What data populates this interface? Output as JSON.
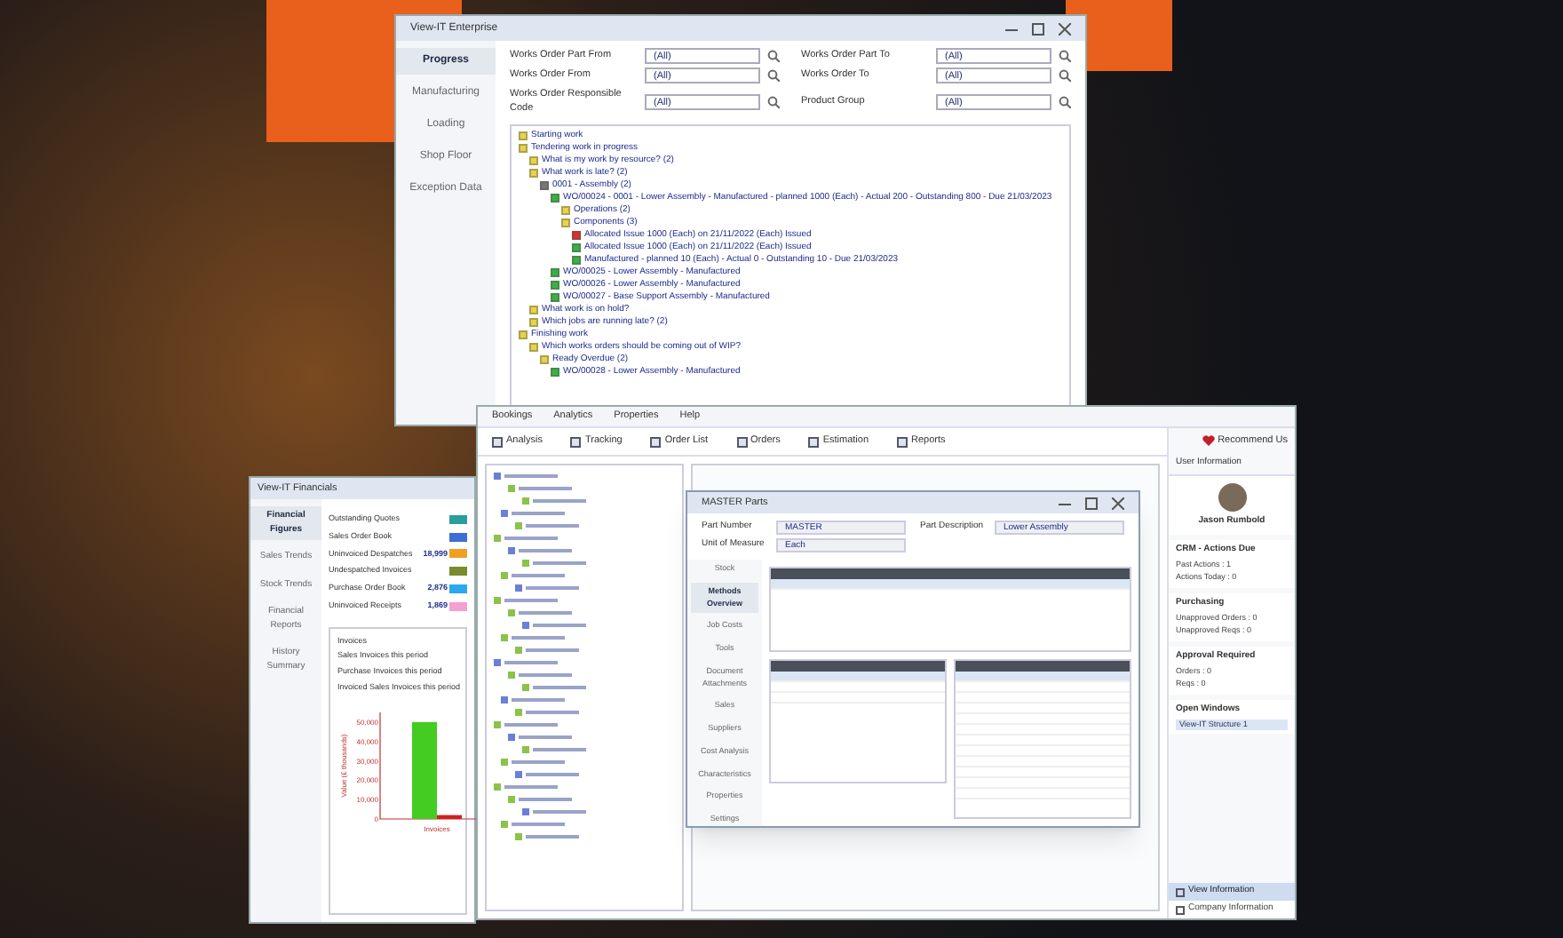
{
  "enterprise_window": {
    "title": "View-IT Enterprise",
    "nav": [
      {
        "label": "Progress",
        "selected": true
      },
      {
        "label": "Manufacturing",
        "selected": false
      },
      {
        "label": "Loading",
        "selected": false
      },
      {
        "label": "Shop Floor",
        "selected": false
      },
      {
        "label": "Exception Data",
        "selected": false
      }
    ],
    "filters": [
      {
        "label": "Works Order Part From",
        "value": "(All)"
      },
      {
        "label": "Works Order From",
        "value": "(All)"
      },
      {
        "label": "Works Order Responsible Code",
        "value": "(All)"
      },
      {
        "label": "Works Order Part To",
        "value": "(All)"
      },
      {
        "label": "Works Order To",
        "value": "(All)"
      },
      {
        "label": "Product Group",
        "value": "(All)"
      }
    ],
    "tree": [
      {
        "label": "Starting work",
        "color": "#e6d44a"
      },
      {
        "label": "Tendering work in progress",
        "color": "#e6d44a",
        "children": [
          {
            "label": "What is my work by resource? (2)",
            "color": "#e6d44a"
          },
          {
            "label": "What work is late? (2)",
            "color": "#e6d44a",
            "children": [
              {
                "label": "0001 - Assembly (2)",
                "color": "#777777",
                "children": [
                  {
                    "label": "WO/00024 - 0001 - Lower Assembly - Manufactured - planned 1000 (Each) - Actual 200 - Outstanding 800 - Due 21/03/2023",
                    "color": "#3cb043",
                    "children": [
                      {
                        "label": "Operations (2)",
                        "color": "#e6d44a"
                      },
                      {
                        "label": "Components (3)",
                        "color": "#e6d44a",
                        "children": [
                          {
                            "label": "Allocated Issue 1000 (Each) on 21/11/2022 (Each) Issued",
                            "color": "#d83030"
                          },
                          {
                            "label": "Allocated Issue 1000 (Each) on 21/11/2022 (Each) Issued",
                            "color": "#3cb043"
                          },
                          {
                            "label": "Manufactured - planned 10 (Each) - Actual 0 - Outstanding 10 - Due 21/03/2023",
                            "color": "#3cb043"
                          }
                        ]
                      }
                    ]
                  },
                  {
                    "label": "WO/00025 - Lower Assembly - Manufactured",
                    "color": "#3cb043"
                  },
                  {
                    "label": "WO/00026 - Lower Assembly - Manufactured",
                    "color": "#3cb043"
                  },
                  {
                    "label": "WO/00027 - Base Support Assembly - Manufactured",
                    "color": "#3cb043"
                  }
                ]
              }
            ]
          },
          {
            "label": "What work is on hold?",
            "color": "#e6d44a"
          },
          {
            "label": "Which jobs are running late? (2)",
            "color": "#e6d44a"
          }
        ]
      },
      {
        "label": "Finishing work",
        "color": "#e6d44a",
        "children": [
          {
            "label": "Which works orders should be coming out of WIP?",
            "color": "#e6d44a",
            "children": [
              {
                "label": "Ready Overdue (2)",
                "color": "#e6d44a",
                "children": [
                  {
                    "label": "WO/00028 - Lower Assembly - Manufactured",
                    "color": "#3cb043"
                  }
                ]
              }
            ]
          }
        ]
      }
    ]
  },
  "erp_window": {
    "menu": [
      {
        "label": "Bookings"
      },
      {
        "label": "Analytics"
      },
      {
        "label": "Properties"
      },
      {
        "label": "Help"
      }
    ],
    "toolbar": [
      {
        "label": "Analysis"
      },
      {
        "label": "Tracking"
      },
      {
        "label": "Order List"
      },
      {
        "label": "Orders"
      },
      {
        "label": "Estimation"
      },
      {
        "label": "Reports"
      }
    ],
    "recommend": "Recommend Us",
    "side_panel": {
      "header": "User Information",
      "user": "Jason Rumbold",
      "sections": [
        {
          "title": "CRM - Actions Due",
          "lines": [
            "Past Actions : 1",
            "Actions Today : 0"
          ]
        },
        {
          "title": "Purchasing",
          "lines": [
            "Unapproved Orders : 0",
            "Unapproved Reqs : 0"
          ]
        },
        {
          "title": "Approval Required",
          "lines": [
            "Orders : 0",
            "Reqs : 0"
          ]
        },
        {
          "title": "Open Windows",
          "lines": [
            "View-IT Structure 1"
          ]
        }
      ],
      "footer": [
        {
          "label": "View Information",
          "selected": true
        },
        {
          "label": "Company Information",
          "selected": false
        }
      ]
    }
  },
  "parts_dialog": {
    "title": "MASTER Parts",
    "fields": [
      {
        "label": "Part Number",
        "value": "MASTER"
      },
      {
        "label": "Part Description",
        "value": "Lower Assembly"
      },
      {
        "label": "Unit of Measure",
        "value": "Each"
      }
    ],
    "nav": [
      {
        "label": "Stock",
        "selected": false
      },
      {
        "label": "Methods Overview",
        "selected": true
      },
      {
        "label": "Job Costs",
        "selected": false
      },
      {
        "label": "Tools",
        "selected": false
      },
      {
        "label": "Document Attachments",
        "selected": false
      },
      {
        "label": "Sales",
        "selected": false
      },
      {
        "label": "Suppliers",
        "selected": false
      },
      {
        "label": "Cost Analysis",
        "selected": false
      },
      {
        "label": "Characteristics",
        "selected": false
      },
      {
        "label": "Properties",
        "selected": false
      },
      {
        "label": "Settings",
        "selected": false
      }
    ]
  },
  "financials_window": {
    "title": "View-IT Financials",
    "nav": [
      {
        "label": "Financial Figures",
        "selected": true
      },
      {
        "label": "Sales Trends",
        "selected": false
      },
      {
        "label": "Stock Trends",
        "selected": false
      },
      {
        "label": "Financial Reports",
        "selected": false
      },
      {
        "label": "History Summary",
        "selected": false
      }
    ],
    "figures": [
      {
        "label": "Outstanding Quotes",
        "color": "#2a9d9d"
      },
      {
        "label": "Sales Order Book",
        "color": "#3b6fd6"
      },
      {
        "label": "Uninvoiced Despatches",
        "value": "18,999",
        "color": "#f0a020"
      },
      {
        "label": "Undespatched Invoices",
        "color": "#7a8a30"
      },
      {
        "label": "Purchase Order Book",
        "value": "2,876",
        "color": "#2aa8f0"
      },
      {
        "label": "Uninvoiced Receipts",
        "value": "1,869",
        "color": "#f4a0d0"
      }
    ],
    "invoices": {
      "title": "Invoices",
      "lines": [
        "Sales Invoices this period",
        "Purchase Invoices this period",
        "Invoiced Sales Invoices this period"
      ],
      "chart_data": {
        "type": "bar",
        "ylabel": "Value (£ thousands)",
        "categories": [
          "Invoices"
        ],
        "series": [
          {
            "color": "#44cc22",
            "values": [
              50000
            ]
          },
          {
            "color": "#d02020",
            "values": [
              2000
            ]
          }
        ],
        "ylim": [
          0,
          55000
        ],
        "yticks": [
          {
            "value": 0,
            "label": "0"
          },
          {
            "value": 10000,
            "label": "10,000"
          },
          {
            "value": 20000,
            "label": "20,000"
          },
          {
            "value": 30000,
            "label": "30,000"
          },
          {
            "value": 40000,
            "label": "40,000"
          },
          {
            "value": 50000,
            "label": "50,000"
          }
        ]
      }
    }
  }
}
